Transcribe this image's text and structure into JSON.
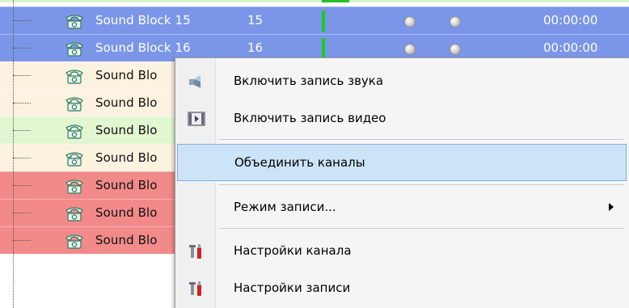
{
  "colors": {
    "selected_row": "#7b96e8",
    "cream_row": "#fbf2df",
    "green_row": "#e2f7d1",
    "red_row": "#f28a8a",
    "menu_highlight": "#cce4f7"
  },
  "rows": [
    {
      "name": "Sound Block 15",
      "number": "15",
      "time": "00:00:00",
      "style": "selected"
    },
    {
      "name": "Sound Block 16",
      "number": "16",
      "time": "00:00:00",
      "style": "selected"
    },
    {
      "name": "Sound Blo",
      "style": "cream"
    },
    {
      "name": "Sound Blo",
      "style": "cream"
    },
    {
      "name": "Sound Blo",
      "style": "green"
    },
    {
      "name": "Sound Blo",
      "style": "cream"
    },
    {
      "name": "Sound Blo",
      "style": "red"
    },
    {
      "name": "Sound Blo",
      "style": "red"
    },
    {
      "name": "Sound Blo",
      "style": "red"
    }
  ],
  "context_menu": {
    "items": [
      {
        "label": "Включить запись звука",
        "icon": "speaker-icon"
      },
      {
        "label": "Включить запись видео",
        "icon": "film-icon"
      },
      {
        "label": "Объединить каналы",
        "icon": "",
        "highlighted": true
      },
      {
        "label": "Режим записи...",
        "icon": "",
        "submenu": true
      },
      {
        "label": "Настройки канала",
        "icon": "settings-tools-icon"
      },
      {
        "label": "Настройки записи",
        "icon": "settings-tools-icon"
      }
    ]
  }
}
